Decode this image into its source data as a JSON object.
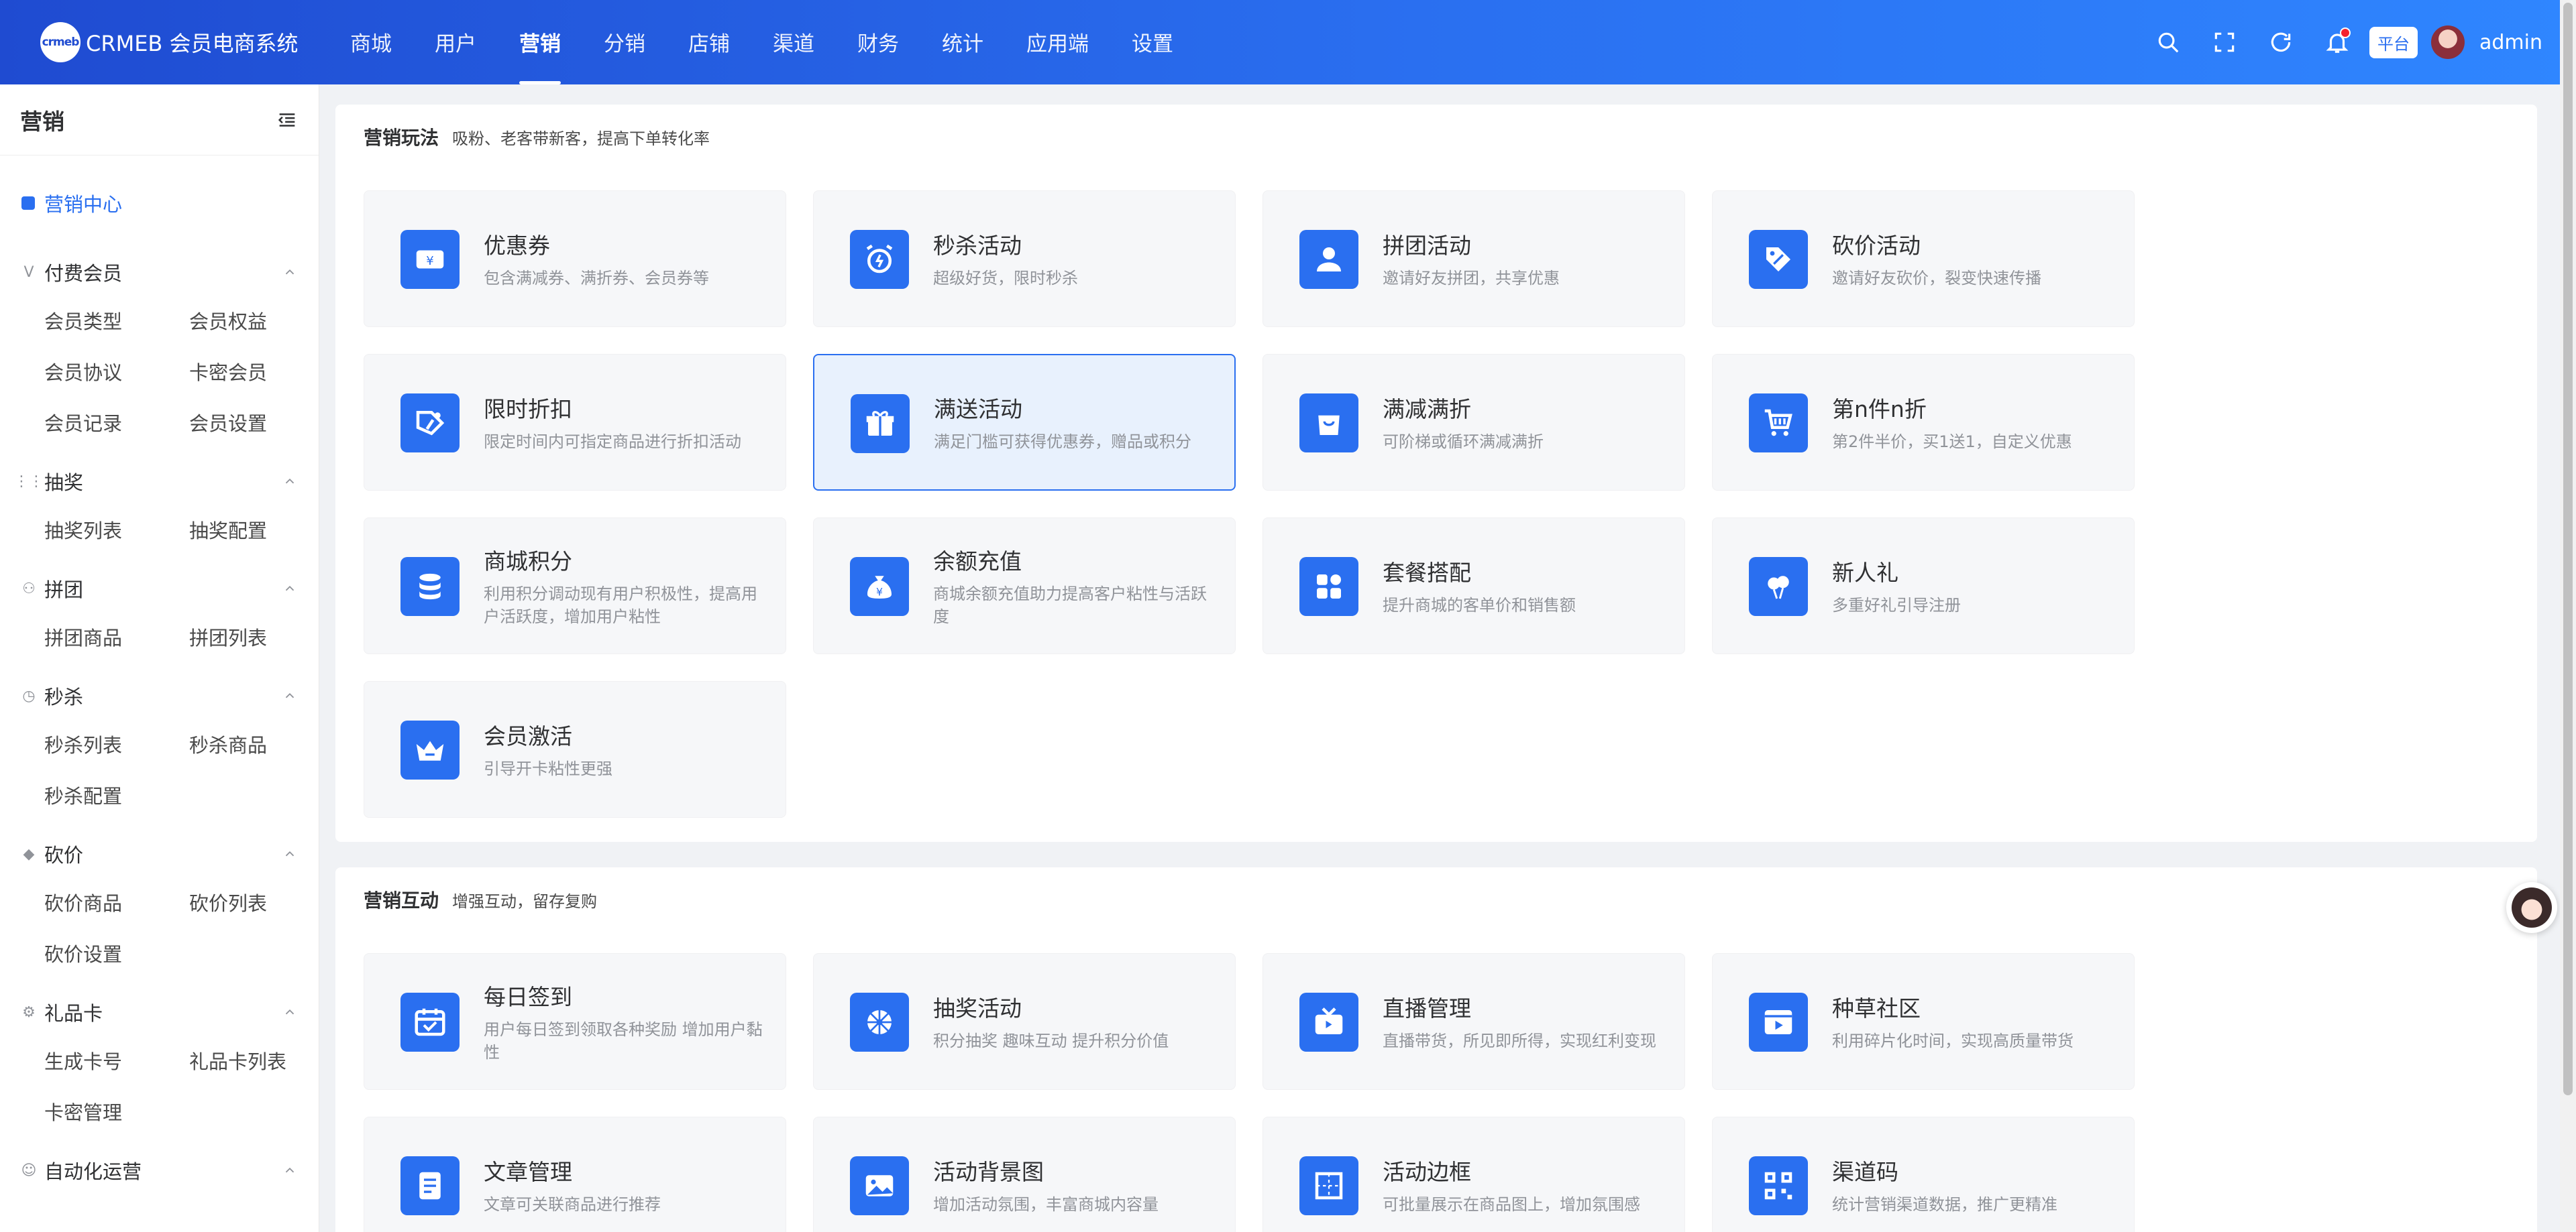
{
  "header": {
    "logo_mark": "crmeb",
    "app_title": "CRMEB 会员电商系统",
    "nav": [
      "商城",
      "用户",
      "营销",
      "分销",
      "店铺",
      "渠道",
      "财务",
      "统计",
      "应用端",
      "设置"
    ],
    "active_nav": "营销",
    "platform_label": "平台",
    "username": "admin",
    "icons": [
      "search-icon",
      "fullscreen-icon",
      "refresh-icon",
      "bell-icon"
    ]
  },
  "sidebar": {
    "title": "营销",
    "center_label": "营销中心",
    "groups": [
      {
        "title": "付费会员",
        "icon": "vip-icon",
        "items": [
          "会员类型",
          "会员权益",
          "会员协议",
          "卡密会员",
          "会员记录",
          "会员设置"
        ]
      },
      {
        "title": "抽奖",
        "icon": "grid-icon",
        "items": [
          "抽奖列表",
          "抽奖配置"
        ]
      },
      {
        "title": "拼团",
        "icon": "group-icon",
        "items": [
          "拼团商品",
          "拼团列表"
        ]
      },
      {
        "title": "秒杀",
        "icon": "clock-icon",
        "items": [
          "秒杀列表",
          "秒杀商品",
          "秒杀配置"
        ]
      },
      {
        "title": "砍价",
        "icon": "tag-icon",
        "items": [
          "砍价商品",
          "砍价列表",
          "砍价设置"
        ]
      },
      {
        "title": "礼品卡",
        "icon": "gear-icon",
        "items": [
          "生成卡号",
          "礼品卡列表",
          "卡密管理"
        ]
      },
      {
        "title": "自动化运营",
        "icon": "robot-icon",
        "items": []
      }
    ]
  },
  "sections": [
    {
      "title": "营销玩法",
      "subtitle": "吸粉、老客带新客，提高下单转化率",
      "cards": [
        {
          "name": "优惠券",
          "desc": "包含满减券、满折券、会员券等",
          "icon": "ticket-icon"
        },
        {
          "name": "秒杀活动",
          "desc": "超级好货，限时秒杀",
          "icon": "alarm-icon"
        },
        {
          "name": "拼团活动",
          "desc": "邀请好友拼团，共享优惠",
          "icon": "users-icon"
        },
        {
          "name": "砍价活动",
          "desc": "邀请好友砍价，裂变快速传播",
          "icon": "price-tag-icon"
        },
        {
          "name": "限时折扣",
          "desc": "限定时间内可指定商品进行折扣活动",
          "icon": "discount-icon"
        },
        {
          "name": "满送活动",
          "desc": "满足门槛可获得优惠券，赠品或积分",
          "icon": "gift-icon",
          "selected": true
        },
        {
          "name": "满减满折",
          "desc": "可阶梯或循环满减满折",
          "icon": "bag-icon"
        },
        {
          "name": "第n件n折",
          "desc": "第2件半价，买1送1，自定义优惠",
          "icon": "cart-icon"
        },
        {
          "name": "商城积分",
          "desc": "利用积分调动现有用户积极性，提高用户活跃度，增加用户粘性",
          "icon": "coins-icon"
        },
        {
          "name": "余额充值",
          "desc": "商城余额充值助力提高客户粘性与活跃度",
          "icon": "money-bag-icon"
        },
        {
          "name": "套餐搭配",
          "desc": "提升商城的客单价和销售额",
          "icon": "bundle-icon"
        },
        {
          "name": "新人礼",
          "desc": "多重好礼引导注册",
          "icon": "balloon-icon"
        },
        {
          "name": "会员激活",
          "desc": "引导开卡粘性更强",
          "icon": "crown-icon"
        }
      ]
    },
    {
      "title": "营销互动",
      "subtitle": "增强互动，留存复购",
      "cards": [
        {
          "name": "每日签到",
          "desc": "用户每日签到领取各种奖励 增加用户黏性",
          "icon": "calendar-icon"
        },
        {
          "name": "抽奖活动",
          "desc": "积分抽奖 趣味互动 提升积分价值",
          "icon": "wheel-icon"
        },
        {
          "name": "直播管理",
          "desc": "直播带货，所见即所得，实现红利变现",
          "icon": "live-icon"
        },
        {
          "name": "种草社区",
          "desc": "利用碎片化时间，实现高质量带货",
          "icon": "video-icon"
        },
        {
          "name": "文章管理",
          "desc": "文章可关联商品进行推荐",
          "icon": "article-icon"
        },
        {
          "name": "活动背景图",
          "desc": "增加活动氛围，丰富商城内容量",
          "icon": "image-icon"
        },
        {
          "name": "活动边框",
          "desc": "可批量展示在商品图上，增加氛围感",
          "icon": "frame-icon"
        },
        {
          "name": "渠道码",
          "desc": "统计营销渠道数据，推广更精准",
          "icon": "qrcode-icon"
        }
      ]
    }
  ],
  "colors": {
    "accent": "#2a6ff0",
    "header_start": "#1f4bd1",
    "header_end": "#2f86ff",
    "card_bg": "#f6f7f9"
  }
}
